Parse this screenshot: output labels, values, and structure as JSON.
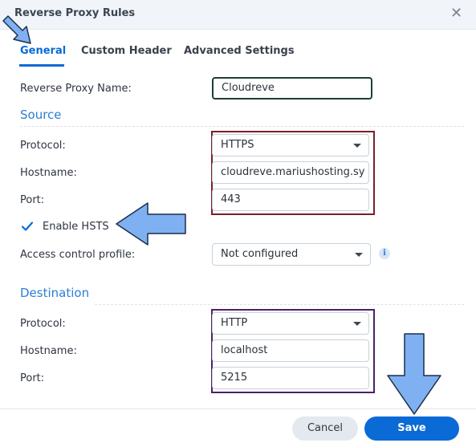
{
  "dialog": {
    "title": "Reverse Proxy Rules",
    "close_icon": "close-icon"
  },
  "tabs": [
    {
      "label": "General",
      "active": true
    },
    {
      "label": "Custom Header",
      "active": false
    },
    {
      "label": "Advanced Settings",
      "active": false
    }
  ],
  "general": {
    "name_label": "Reverse Proxy Name:",
    "name_value": "Cloudreve"
  },
  "source": {
    "heading": "Source",
    "protocol_label": "Protocol:",
    "protocol_value": "HTTPS",
    "hostname_label": "Hostname:",
    "hostname_value": "cloudreve.mariushosting.sy",
    "port_label": "Port:",
    "port_value": "443",
    "hsts_label": "Enable HSTS",
    "hsts_checked": true,
    "access_label": "Access control profile:",
    "access_value": "Not configured",
    "info_icon": "i"
  },
  "destination": {
    "heading": "Destination",
    "protocol_label": "Protocol:",
    "protocol_value": "HTTP",
    "hostname_label": "Hostname:",
    "hostname_value": "localhost",
    "port_label": "Port:",
    "port_value": "5215"
  },
  "footer": {
    "cancel_label": "Cancel",
    "save_label": "Save"
  },
  "colors": {
    "accent": "#0a6ad6",
    "source_highlight": "#7a1f2a",
    "destination_highlight": "#4b2266",
    "name_highlight": "#1f3d3a",
    "annotation_arrow": "#7fb0f2"
  }
}
